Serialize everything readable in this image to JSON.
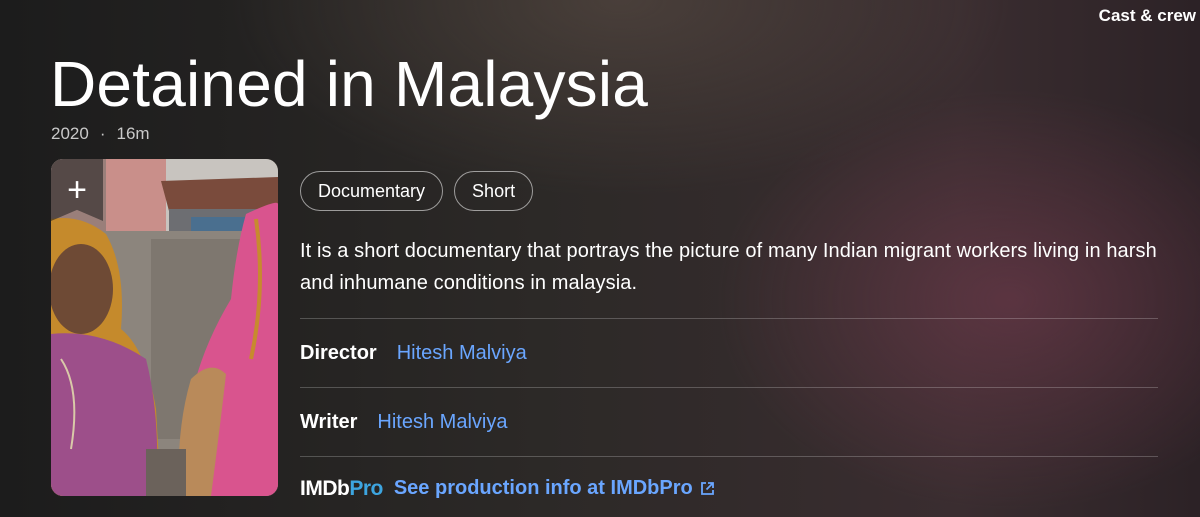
{
  "header": {
    "cast_crew_label": "Cast & crew"
  },
  "title": {
    "text": "Detained in Malaysia",
    "year": "2020",
    "separator": "·",
    "runtime": "16m"
  },
  "poster": {
    "add_icon": "plus-icon",
    "add_glyph": "+"
  },
  "genres": [
    "Documentary",
    "Short"
  ],
  "plot": "It is a short documentary that portrays the picture of many Indian migrant workers living in harsh and inhumane conditions in malaysia.",
  "credits": [
    {
      "label": "Director",
      "names": "Hitesh Malviya"
    },
    {
      "label": "Writer",
      "names": "Hitesh Malviya"
    }
  ],
  "imdbpro": {
    "logo_imdb": "IMDb",
    "logo_pro": "Pro",
    "link_label": "See production info at IMDbPro",
    "link_icon": "external-link-icon"
  },
  "colors": {
    "link": "#6aa6ff",
    "pro_accent": "#3da5e0"
  }
}
